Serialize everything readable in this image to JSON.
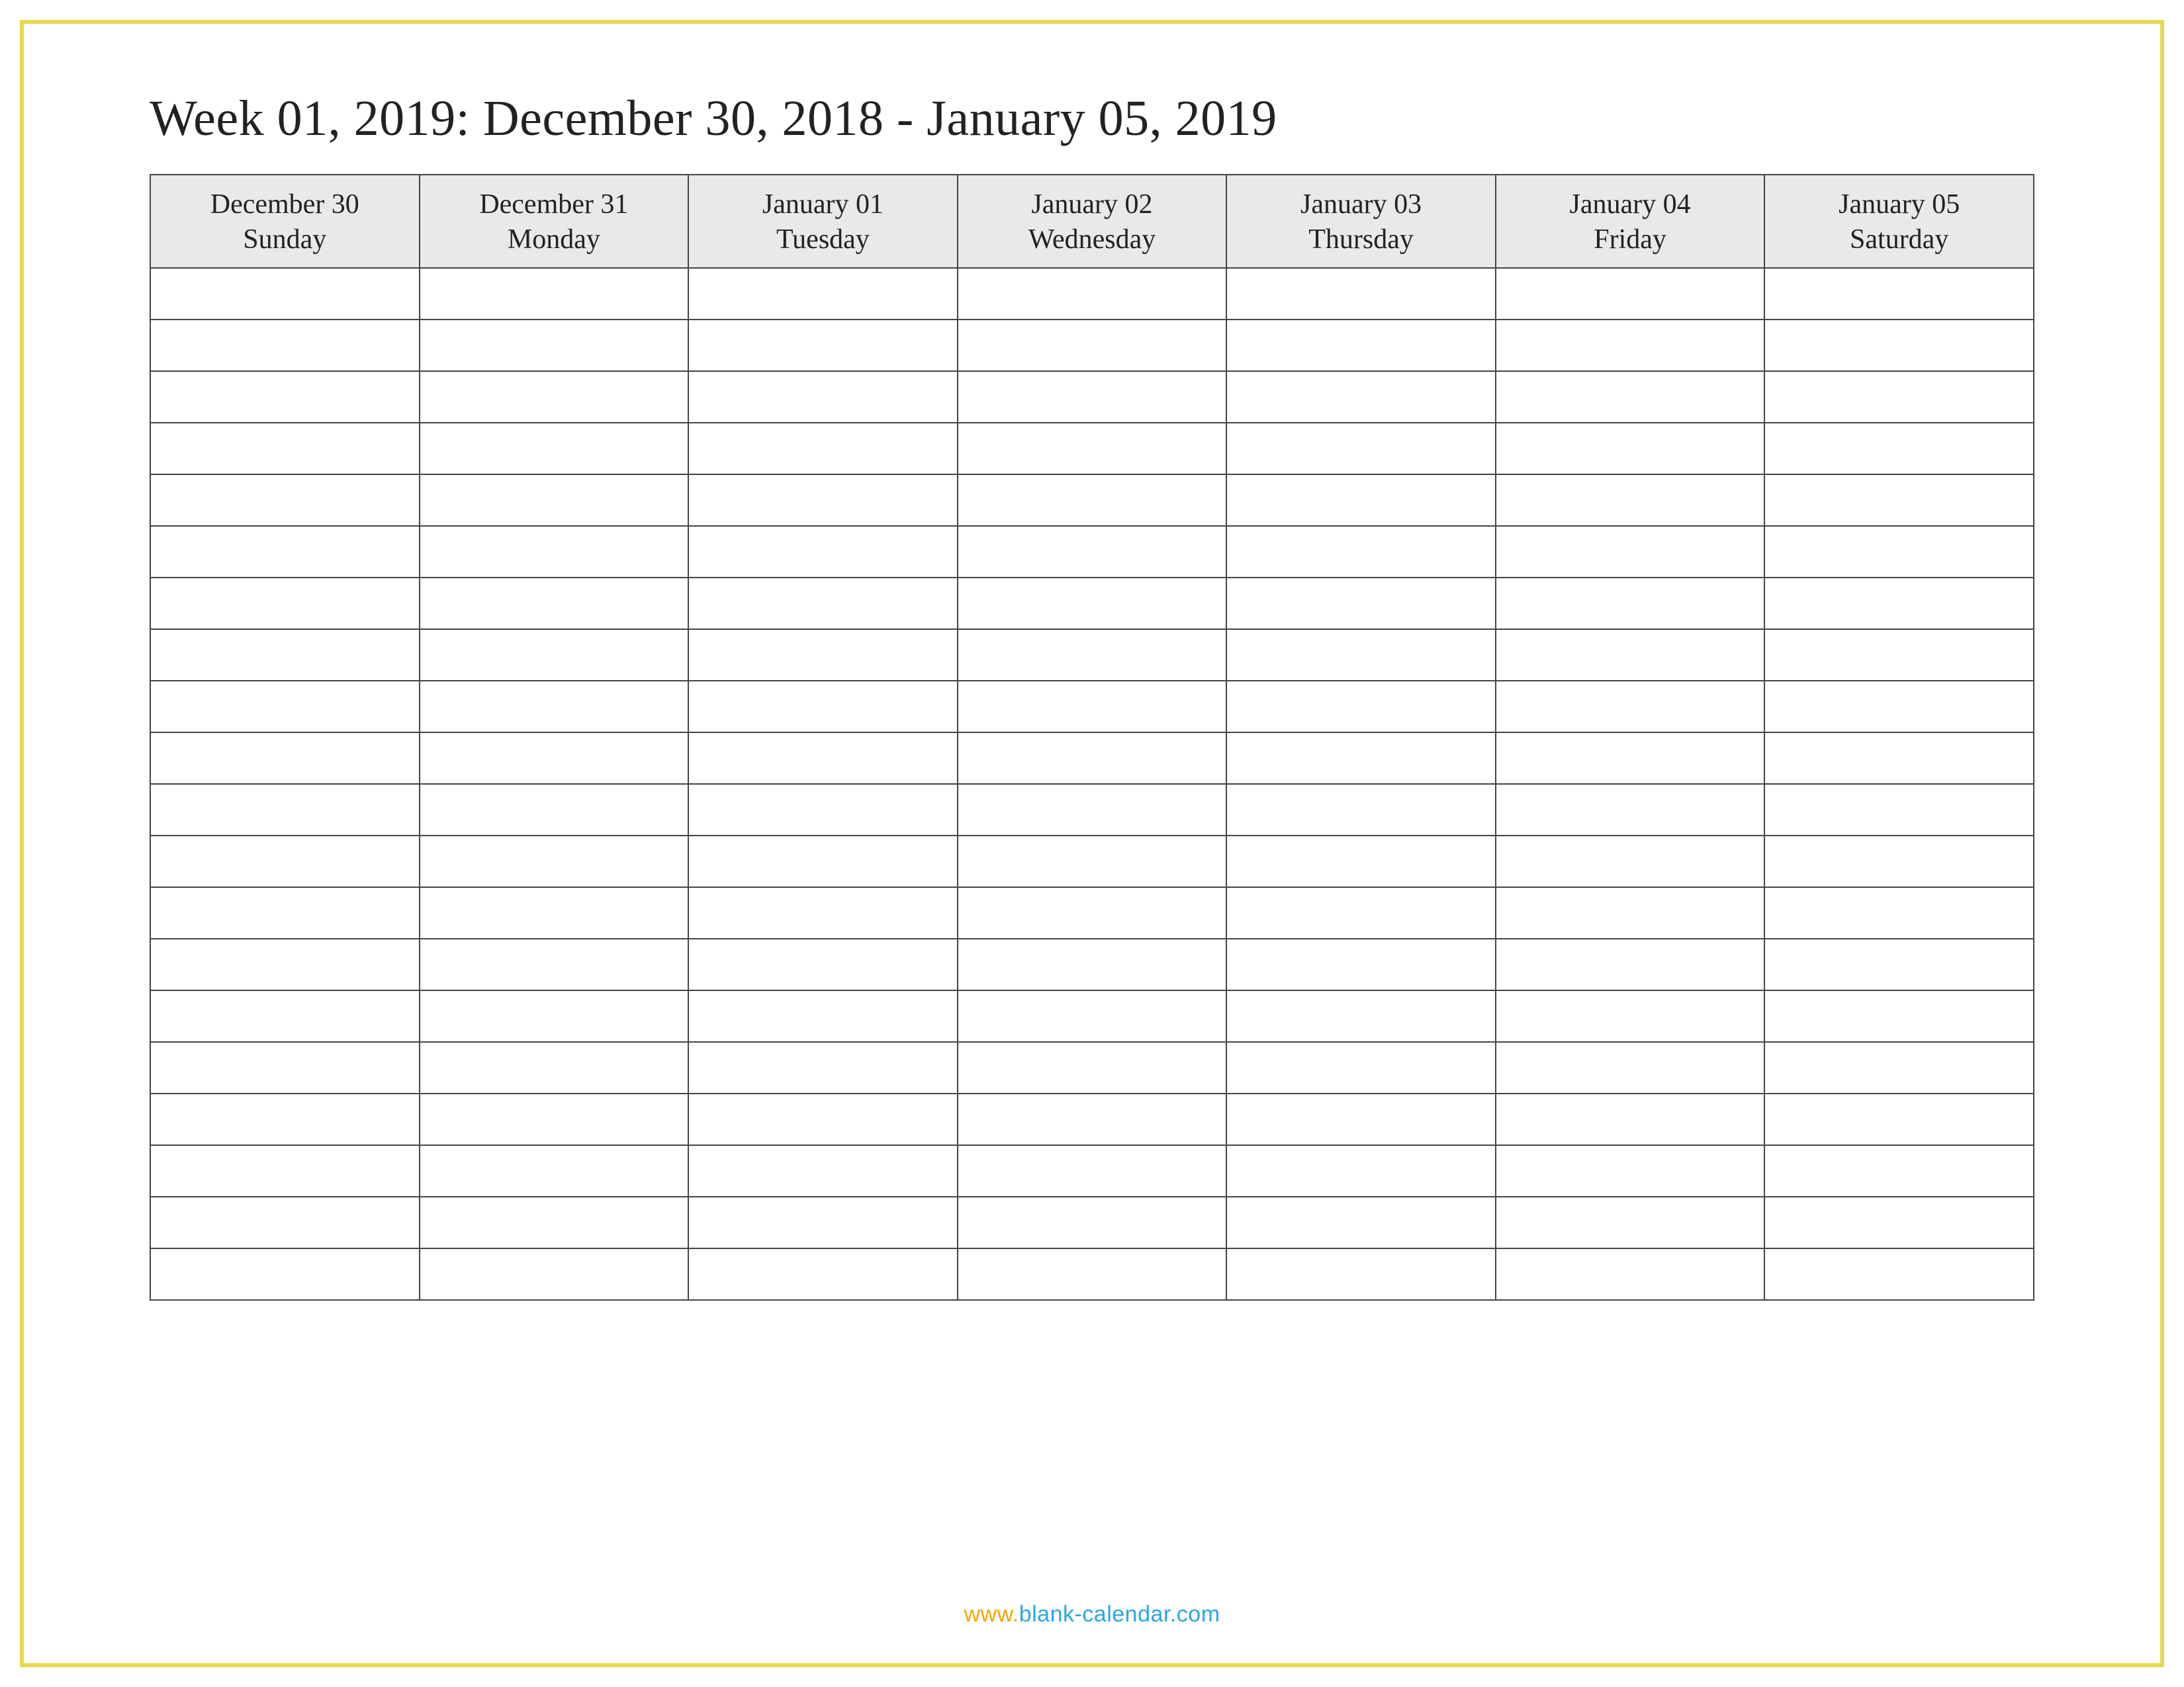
{
  "title": "Week 01, 2019: December 30, 2018 - January 05, 2019",
  "columns": [
    {
      "date": "December 30",
      "day": "Sunday"
    },
    {
      "date": "December 31",
      "day": "Monday"
    },
    {
      "date": "January 01",
      "day": "Tuesday"
    },
    {
      "date": "January 02",
      "day": "Wednesday"
    },
    {
      "date": "January 03",
      "day": "Thursday"
    },
    {
      "date": "January 04",
      "day": "Friday"
    },
    {
      "date": "January 05",
      "day": "Saturday"
    }
  ],
  "blank_rows": 20,
  "footer": {
    "part1": "www.",
    "part2": "blank-calendar.com"
  }
}
